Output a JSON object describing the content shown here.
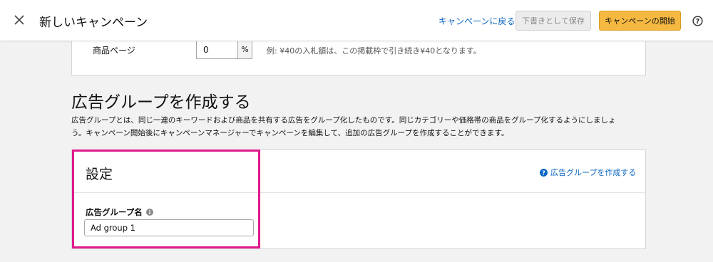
{
  "header": {
    "title": "新しいキャンペーン",
    "back_link": "キャンペーンに戻る",
    "draft_button": "下書きとして保存",
    "start_button": "キャンペーンの開始"
  },
  "bid": {
    "label": "商品ページ",
    "value": "0",
    "suffix": "%",
    "example": "例: ¥40の入札額は、この掲載枠で引き続き¥40となります。"
  },
  "ad_group_section": {
    "heading": "広告グループを作成する",
    "description_line1": "広告グループとは、同じ一連のキーワードおよび商品を共有する広告をグループ化したものです。同じカテゴリーや価格帯の商品をグループ化するようにしましょ",
    "description_line2": "う。キャンペーン開始後にキャンペーンマネージャーでキャンペーンを編集して、追加の広告グループを作成することができます。"
  },
  "settings": {
    "title": "設定",
    "create_link": "広告グループを作成する",
    "name_label": "広告グループ名",
    "name_value": "Ad group 1"
  },
  "colors": {
    "link": "#0a66c2",
    "primary_button": "#f5b942",
    "highlight": "#e0198c"
  },
  "icons": [
    "close-icon",
    "help-icon",
    "question-circle-icon",
    "info-icon"
  ]
}
